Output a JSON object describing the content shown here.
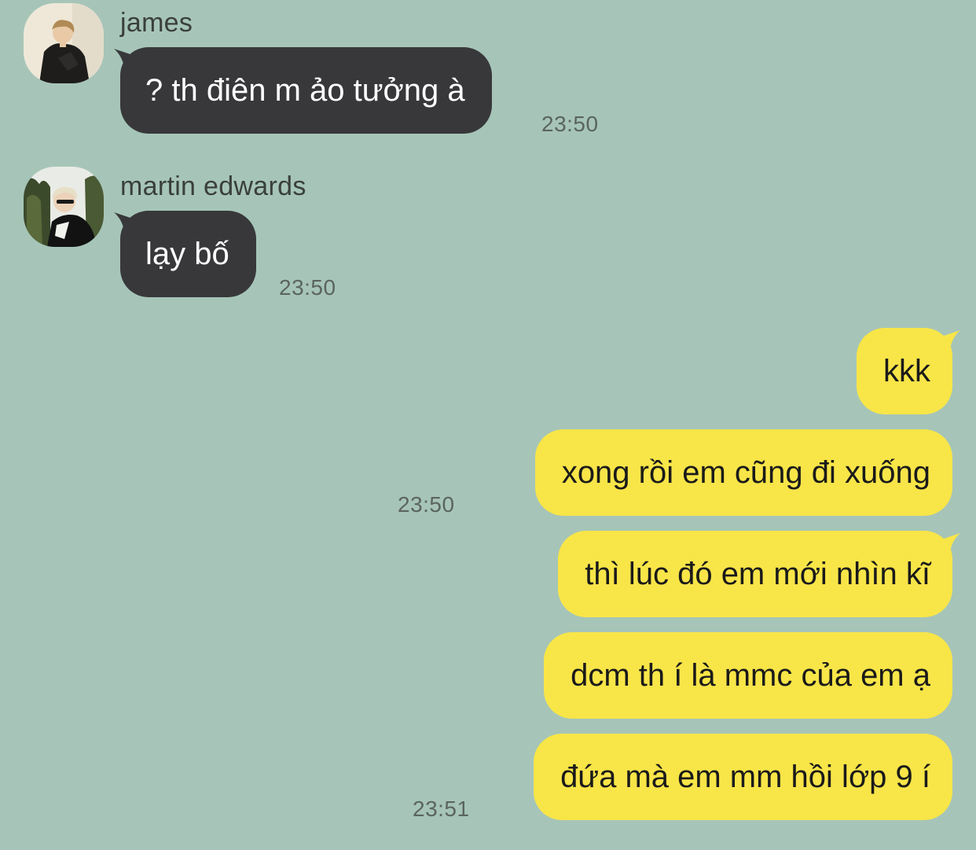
{
  "messages": [
    {
      "sender": "james",
      "text": "? th điên m ảo tưởng à",
      "time": "23:50"
    },
    {
      "sender": "martin edwards",
      "text": "lạy bố",
      "time": "23:50"
    },
    {
      "text": "kkk"
    },
    {
      "text": "xong rồi em cũng đi xuống",
      "time": "23:50"
    },
    {
      "text": "thì lúc đó em mới nhìn kĩ"
    },
    {
      "text": "dcm th í là mmc của em ạ"
    },
    {
      "text": "đứa mà em mm hồi lớp 9 í",
      "time": "23:51"
    }
  ],
  "colors": {
    "background": "#a6c5b8",
    "incoming_bubble": "#38383b",
    "outgoing_bubble": "#f8e548",
    "timestamp": "#5b6460"
  },
  "icons": {
    "james_avatar": "avatar-photo-person-dark-jacket",
    "martin_avatar": "avatar-photo-person-glasses-trees"
  }
}
